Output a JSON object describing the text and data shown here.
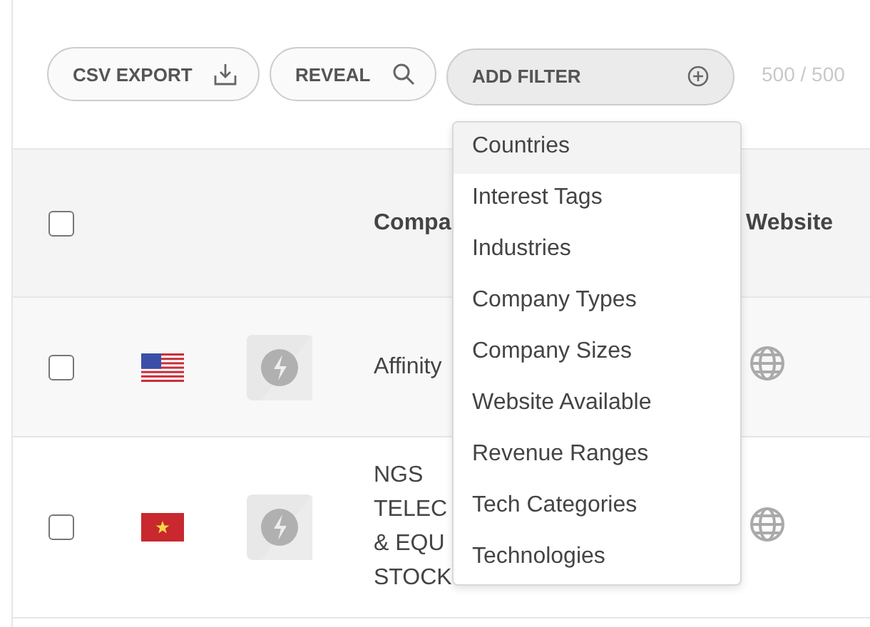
{
  "toolbar": {
    "buttons": [
      {
        "label": "CSV EXPORT",
        "kind": "download"
      },
      {
        "label": "REVEAL",
        "kind": "search"
      }
    ],
    "filter": {
      "label": "ADD FILTER",
      "expanded": true
    },
    "count": "500 / 500"
  },
  "filter_menu": [
    {
      "label": "Countries",
      "selected": true
    },
    {
      "label": "Interest Tags",
      "selected": false
    },
    {
      "label": "Industries",
      "selected": false
    },
    {
      "label": "Company Types",
      "selected": false
    },
    {
      "label": "Company Sizes",
      "selected": false
    },
    {
      "label": "Website Available",
      "selected": false
    },
    {
      "label": "Revenue Ranges",
      "selected": false
    },
    {
      "label": "Tech Categories",
      "selected": false
    },
    {
      "label": "Technologies",
      "selected": false
    }
  ],
  "table": {
    "header": {
      "checked": false,
      "company": "Compa",
      "website": "Website"
    },
    "rows": [
      {
        "checked": false,
        "kind": "us",
        "company": "Affinity"
      },
      {
        "checked": false,
        "kind": "vn",
        "company": "NGS TELEC & EQU STOCK"
      }
    ]
  }
}
